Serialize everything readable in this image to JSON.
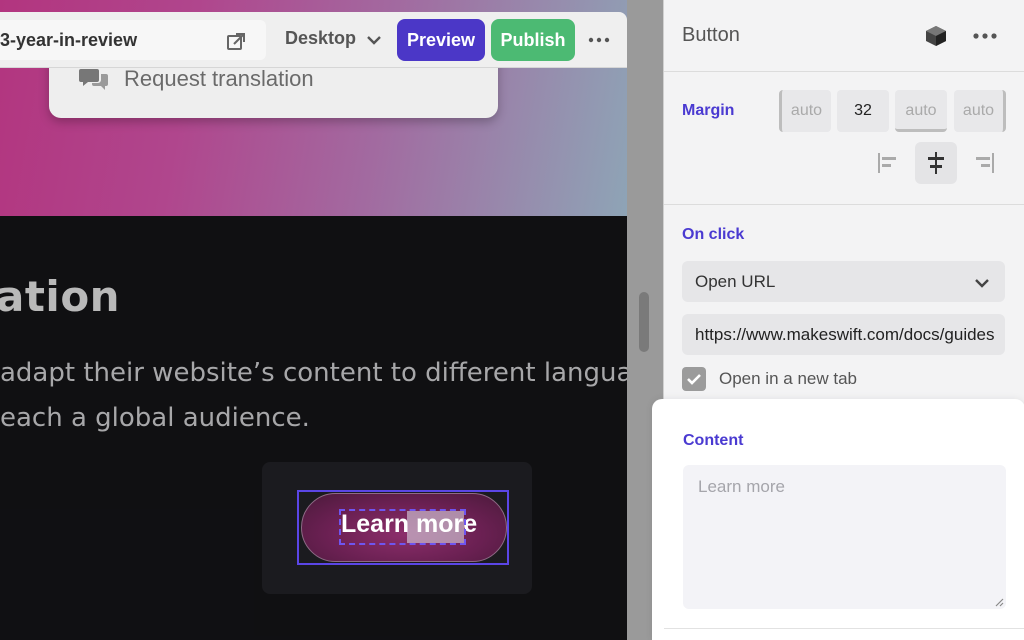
{
  "toolbar": {
    "url_slug": "3-year-in-review",
    "device": "Desktop",
    "preview_label": "Preview",
    "publish_label": "Publish"
  },
  "popover": {
    "request_translation_label": "Request translation"
  },
  "canvas": {
    "heading_partial": "ation",
    "body_line_1": "adapt their website’s content to different languages, re",
    "body_line_2": "each a global audience.",
    "button_label": "Learn more"
  },
  "panel": {
    "title": "Button",
    "margin": {
      "label": "Margin",
      "left": "auto",
      "top": "32",
      "right": "auto",
      "bottom": "auto"
    },
    "on_click": {
      "label": "On click",
      "action": "Open URL",
      "url": "https://www.makeswift.com/docs/guides",
      "open_new_tab_label": "Open in a new tab",
      "open_new_tab_checked": true
    },
    "content": {
      "label": "Content",
      "placeholder": "Learn more"
    }
  },
  "colors": {
    "accent": "#4a3ad1",
    "preview_button": "#4b37c7",
    "publish_button": "#4cba73",
    "selection": "#5b46e6"
  },
  "icons": [
    "external-link-icon",
    "chevron-down-icon",
    "more-horizontal-icon",
    "chat-bubble-icon",
    "cube-icon",
    "align-left-icon",
    "align-center-icon",
    "align-right-icon",
    "checkmark-icon",
    "resize-handle-icon"
  ]
}
